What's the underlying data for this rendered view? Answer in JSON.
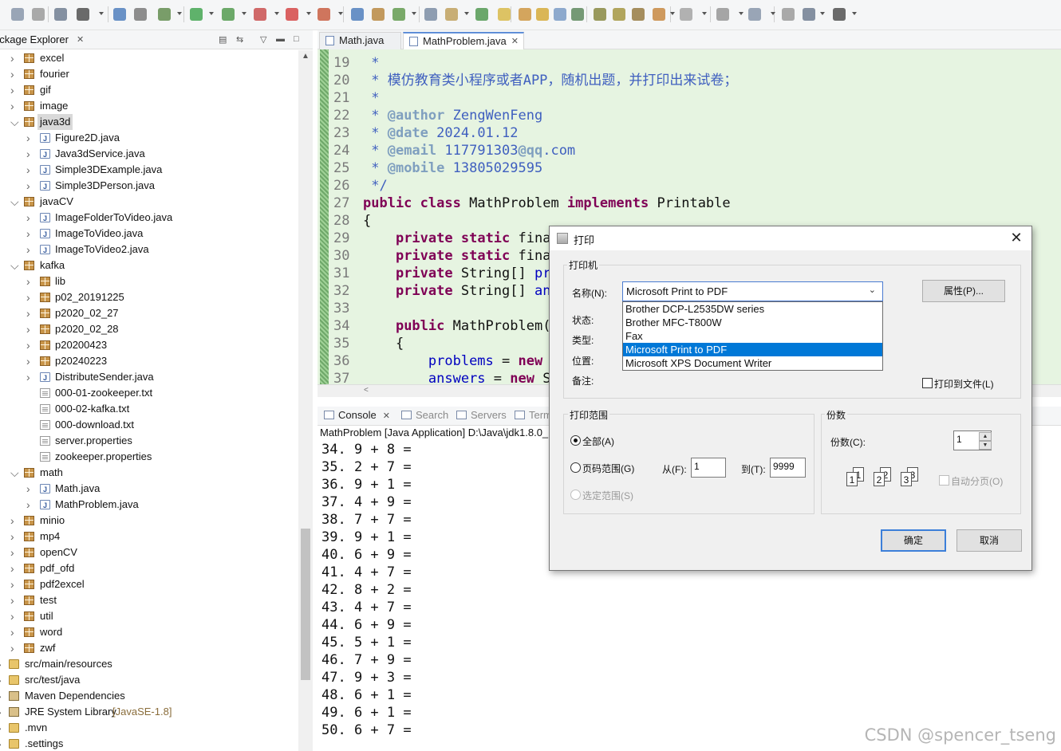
{
  "package_explorer": {
    "title": "ackage Explorer",
    "tree": [
      {
        "label": "excel",
        "kind": "pkg",
        "level": 0,
        "tw": ">"
      },
      {
        "label": "fourier",
        "kind": "pkg",
        "level": 0,
        "tw": ">"
      },
      {
        "label": "gif",
        "kind": "pkg",
        "level": 0,
        "tw": ">"
      },
      {
        "label": "image",
        "kind": "pkg",
        "level": 0,
        "tw": ">"
      },
      {
        "label": "java3d",
        "kind": "pkg",
        "level": 0,
        "tw": "v",
        "selected": true
      },
      {
        "label": "Figure2D.java",
        "kind": "java",
        "level": 1,
        "tw": ">"
      },
      {
        "label": "Java3dService.java",
        "kind": "java",
        "level": 1,
        "tw": ">"
      },
      {
        "label": "Simple3DExample.java",
        "kind": "java",
        "level": 1,
        "tw": ">"
      },
      {
        "label": "Simple3DPerson.java",
        "kind": "java",
        "level": 1,
        "tw": ">"
      },
      {
        "label": "javaCV",
        "kind": "pkg",
        "level": 0,
        "tw": "v"
      },
      {
        "label": "ImageFolderToVideo.java",
        "kind": "java",
        "level": 1,
        "tw": ">"
      },
      {
        "label": "ImageToVideo.java",
        "kind": "java",
        "level": 1,
        "tw": ">"
      },
      {
        "label": "ImageToVideo2.java",
        "kind": "java",
        "level": 1,
        "tw": ">"
      },
      {
        "label": "kafka",
        "kind": "pkg",
        "level": 0,
        "tw": "v"
      },
      {
        "label": "lib",
        "kind": "pkg",
        "level": 1,
        "tw": ">"
      },
      {
        "label": "p02_20191225",
        "kind": "pkg",
        "level": 1,
        "tw": ">"
      },
      {
        "label": "p2020_02_27",
        "kind": "pkg",
        "level": 1,
        "tw": ">"
      },
      {
        "label": "p2020_02_28",
        "kind": "pkg",
        "level": 1,
        "tw": ">"
      },
      {
        "label": "p20200423",
        "kind": "pkg",
        "level": 1,
        "tw": ">"
      },
      {
        "label": "p20240223",
        "kind": "pkg",
        "level": 1,
        "tw": ">"
      },
      {
        "label": "DistributeSender.java",
        "kind": "java",
        "level": 1,
        "tw": ">"
      },
      {
        "label": "000-01-zookeeper.txt",
        "kind": "txt",
        "level": 1,
        "tw": ""
      },
      {
        "label": "000-02-kafka.txt",
        "kind": "txt",
        "level": 1,
        "tw": ""
      },
      {
        "label": "000-download.txt",
        "kind": "txt",
        "level": 1,
        "tw": ""
      },
      {
        "label": "server.properties",
        "kind": "txt",
        "level": 1,
        "tw": ""
      },
      {
        "label": "zookeeper.properties",
        "kind": "txt",
        "level": 1,
        "tw": ""
      },
      {
        "label": "math",
        "kind": "pkg",
        "level": 0,
        "tw": "v"
      },
      {
        "label": "Math.java",
        "kind": "java",
        "level": 1,
        "tw": ">"
      },
      {
        "label": "MathProblem.java",
        "kind": "java",
        "level": 1,
        "tw": ">"
      },
      {
        "label": "minio",
        "kind": "pkg",
        "level": 0,
        "tw": ">"
      },
      {
        "label": "mp4",
        "kind": "pkg",
        "level": 0,
        "tw": ">"
      },
      {
        "label": "openCV",
        "kind": "pkg",
        "level": 0,
        "tw": ">"
      },
      {
        "label": "pdf_ofd",
        "kind": "pkg",
        "level": 0,
        "tw": ">"
      },
      {
        "label": "pdf2excel",
        "kind": "pkg",
        "level": 0,
        "tw": ">"
      },
      {
        "label": "test",
        "kind": "pkg",
        "level": 0,
        "tw": ">"
      },
      {
        "label": "util",
        "kind": "pkg",
        "level": 0,
        "tw": ">"
      },
      {
        "label": "word",
        "kind": "pkg",
        "level": 0,
        "tw": ">"
      },
      {
        "label": "zwf",
        "kind": "pkg",
        "level": 0,
        "tw": ">"
      },
      {
        "label": "src/main/resources",
        "kind": "fld",
        "level": -1,
        "tw": ">"
      },
      {
        "label": "src/test/java",
        "kind": "fld",
        "level": -1,
        "tw": ">"
      },
      {
        "label": "Maven Dependencies",
        "kind": "lib",
        "level": -1,
        "tw": ">"
      },
      {
        "label": "JRE System Library",
        "deco": "[JavaSE-1.8]",
        "kind": "lib",
        "level": -1,
        "tw": ">"
      },
      {
        "label": ".mvn",
        "kind": "fld",
        "level": -1,
        "tw": ">"
      },
      {
        "label": ".settings",
        "kind": "fld",
        "level": -1,
        "tw": ">"
      }
    ]
  },
  "editor": {
    "tabs": [
      {
        "label": "Math.java",
        "active": false
      },
      {
        "label": "MathProblem.java",
        "active": true
      }
    ],
    "lines": [
      {
        "n": "19",
        "code": " *"
      },
      {
        "n": "20",
        "code": " * 模仿教育类小程序或者APP，随机出题，并打印出来试卷；"
      },
      {
        "n": "21",
        "code": " *"
      },
      {
        "n": "22",
        "code": " * @author ZengWenFeng"
      },
      {
        "n": "23",
        "code": " * @date 2024.01.12"
      },
      {
        "n": "24",
        "code": " * @email 117791303@qq.com"
      },
      {
        "n": "25",
        "code": " * @mobile 13805029595"
      },
      {
        "n": "26",
        "code": " */"
      },
      {
        "n": "27",
        "code": "public class MathProblem implements Printable"
      },
      {
        "n": "28",
        "code": "{"
      },
      {
        "n": "29",
        "code": "    private static fina"
      },
      {
        "n": "30",
        "code": "    private static fina"
      },
      {
        "n": "31",
        "code": "    private String[] pro"
      },
      {
        "n": "32",
        "code": "    private String[] ans"
      },
      {
        "n": "33",
        "code": ""
      },
      {
        "n": "34",
        "code": "    public MathProblem()"
      },
      {
        "n": "35",
        "code": "    {"
      },
      {
        "n": "36",
        "code": "        problems = new S"
      },
      {
        "n": "37",
        "code": "        answers = new St"
      }
    ]
  },
  "console": {
    "tabs": [
      "Console",
      "Search",
      "Servers",
      "Term"
    ],
    "description": "MathProblem [Java Application] D:\\Java\\jdk1.8.0_",
    "lines": [
      "34. 9 + 8 =",
      "35. 2 + 7 =",
      "36. 9 + 1 =",
      "37. 4 + 9 =",
      "38. 7 + 7 =",
      "39. 9 + 1 =",
      "40. 6 + 9 =",
      "41. 4 + 7 =",
      "42. 8 + 2 =",
      "43. 4 + 7 =",
      "44. 6 + 9 =",
      "45. 5 + 1 =",
      "46. 7 + 9 =",
      "47. 9 + 3 =",
      "48. 6 + 1 =",
      "49. 6 + 1 =",
      "50. 6 + 7 ="
    ]
  },
  "dialog": {
    "title": "打印",
    "printer_group": "打印机",
    "name_label": "名称(N):",
    "selected_printer": "Microsoft Print to PDF",
    "printer_options": [
      "Brother DCP-L2535DW series",
      "Brother MFC-T800W",
      "Fax",
      "Microsoft Print to PDF",
      "Microsoft XPS Document Writer"
    ],
    "selected_index": 3,
    "properties_button": "属性(P)...",
    "status_label": "状态:",
    "type_label": "类型:",
    "location_label": "位置:",
    "comment_label": "备注:",
    "print_to_file": "打印到文件(L)",
    "range_group": "打印范围",
    "range_all": "全部(A)",
    "range_pages": "页码范围(G)",
    "range_selection": "选定范围(S)",
    "from_label": "从(F):",
    "from_value": "1",
    "to_label": "到(T):",
    "to_value": "9999",
    "copies_group": "份数",
    "copies_label": "份数(C):",
    "copies_value": "1",
    "collate_label": "自动分页(O)",
    "collate_pages": [
      "1",
      "1",
      "2",
      "2",
      "3",
      "3"
    ],
    "ok_button": "确定",
    "cancel_button": "取消"
  },
  "watermark": "CSDN @spencer_tseng"
}
